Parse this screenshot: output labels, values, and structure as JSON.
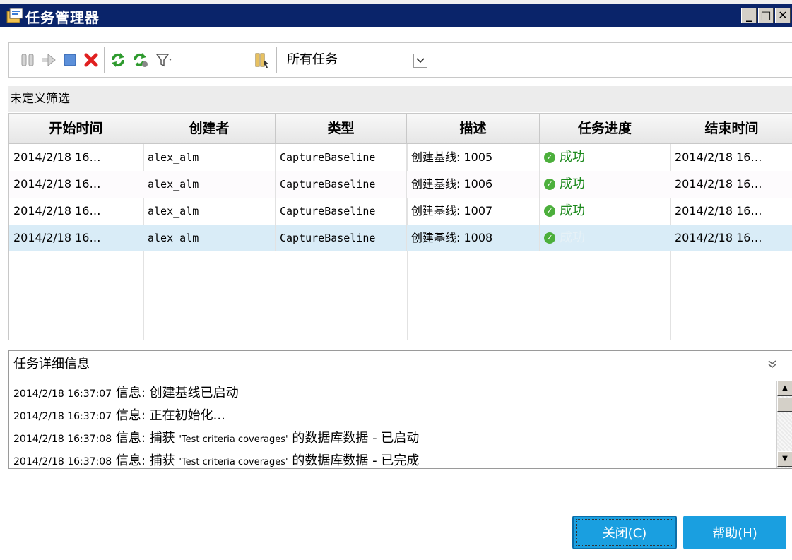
{
  "window": {
    "title": "任务管理器",
    "controls": {
      "minimize": "_",
      "maximize": "□",
      "close": "✕"
    }
  },
  "toolbar": {
    "icons": [
      "pause-icon",
      "resume-icon",
      "stop-icon",
      "delete-icon",
      "refresh-icon",
      "auto-refresh-icon",
      "filter-icon",
      "select-columns-icon"
    ],
    "filter_value": "所有任务"
  },
  "filter_bar": {
    "label": "未定义筛选"
  },
  "table": {
    "columns": [
      "开始时间",
      "创建者",
      "类型",
      "描述",
      "任务进度",
      "结束时间"
    ],
    "rows": [
      {
        "start": "2014/2/18 16…",
        "creator": "alex_alm",
        "type": "CaptureBaseline",
        "desc": "创建基线: 1005",
        "status": "成功",
        "end": "2014/2/18 16…"
      },
      {
        "start": "2014/2/18 16…",
        "creator": "alex_alm",
        "type": "CaptureBaseline",
        "desc": "创建基线: 1006",
        "status": "成功",
        "end": "2014/2/18 16…"
      },
      {
        "start": "2014/2/18 16…",
        "creator": "alex_alm",
        "type": "CaptureBaseline",
        "desc": "创建基线: 1007",
        "status": "成功",
        "end": "2014/2/18 16…"
      },
      {
        "start": "2014/2/18 16…",
        "creator": "alex_alm",
        "type": "CaptureBaseline",
        "desc": "创建基线: 1008",
        "status": "成功",
        "end": "2014/2/18 16…"
      }
    ],
    "selected_row": 3
  },
  "details": {
    "title": "任务详细信息",
    "lines": [
      {
        "time": "2014/2/18 16:37:07",
        "text": " 信息: 创建基线已启动"
      },
      {
        "time": "2014/2/18 16:37:07",
        "text": " 信息: 正在初始化..."
      },
      {
        "time": "2014/2/18 16:37:08",
        "text_pre": " 信息: 捕获 ",
        "text_en": "'Test criteria coverages'",
        "text_post": " 的数据库数据 - 已启动"
      },
      {
        "time": "2014/2/18 16:37:08",
        "text_pre": " 信息: 捕获 ",
        "text_en": "'Test criteria coverages'",
        "text_post": " 的数据库数据 - 已完成"
      }
    ]
  },
  "buttons": {
    "close": "关闭(C)",
    "help": "帮助(H)"
  },
  "colors": {
    "titlebar": "#0a246a",
    "button": "#1a9fe0",
    "success": "#1e8a1e",
    "selected_row": "#d9ecf7"
  }
}
